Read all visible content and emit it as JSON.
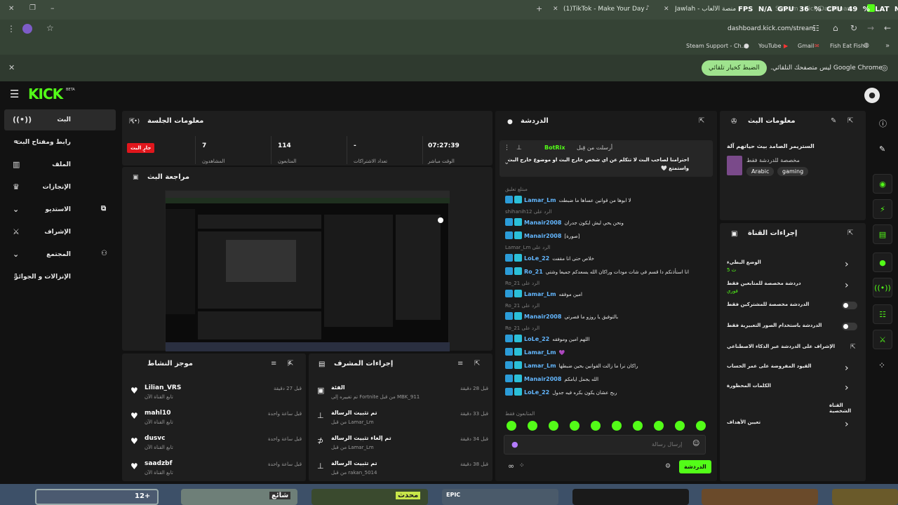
{
  "browser": {
    "tabs": [
      "(1)TikTok - Make Your Day",
      "Jawlah - منصة الألعاب",
      "Stream - Kick Dashboard"
    ],
    "overlay": "FPS N/A  GPU 36 %  CPU 49 %  LAT N/A",
    "url": "dashboard.kick.com/stream",
    "bookmarks": [
      "Steam Support - Ch...",
      "YouTube",
      "Gmail",
      "Fish Eat Fish"
    ],
    "infobar_text": "Google Chrome ليس متصفحك التلقائي.",
    "infobar_button": "الضبط كخيار تلقائي"
  },
  "kick": {
    "logo": "KICK",
    "beta": "BETA"
  },
  "sidebar": {
    "items": [
      {
        "label": "البث",
        "icon": "broadcast-icon",
        "active": true
      },
      {
        "label": "رابط ومفتاح البث",
        "icon": "link-icon"
      },
      {
        "label": "الملف",
        "icon": "chart-icon"
      },
      {
        "label": "الإنجازات",
        "icon": "trophy-icon"
      },
      {
        "label": "الاستديو",
        "icon": "studio-icon"
      },
      {
        "label": "الإشراف",
        "icon": "sword-icon"
      },
      {
        "label": "المجتمع",
        "icon": "community-icon"
      },
      {
        "label": "الإنزالات و الجوائز",
        "icon": "drops-icon"
      }
    ]
  },
  "session": {
    "title": "معلومات الجلسة",
    "live_badge": "جارٍ البث",
    "stats": [
      {
        "value": "07:27:39",
        "label": "الوقت مباشر"
      },
      {
        "value": "-",
        "label": "تعداد الاشتراكات"
      },
      {
        "value": "114",
        "label": "المتابعون"
      },
      {
        "value": "7",
        "label": "المشاهدون"
      }
    ]
  },
  "preview": {
    "title": "مراجعة البث"
  },
  "chat": {
    "title": "الدردشة",
    "pinned": {
      "header": "أرسلت من قِبل",
      "user": "BotRix",
      "text": "احترامنا لصاحب البث لا تتكلم عن اي شخص خارج البث او موضوع خارج البث واستمتع 🤍"
    },
    "messages": [
      {
        "user": "Lamar_Lm",
        "text": "لا ابوها من قوانين عساها ما ضبطت",
        "reply": "مبتلع تعليق"
      },
      {
        "user": "Manair2008",
        "text": "ونحن يحي ليش ايكون جدران",
        "reply": "الرد على shihanih12"
      },
      {
        "user": "Manair2008",
        "text": "[صورة]",
        "reply": ""
      },
      {
        "user": "LoLe_22",
        "text": "خلاص حتى انا مقفت",
        "reply": "الرد على Lamar_Lm"
      },
      {
        "user": "Ro_21",
        "text": "انا استأذنكم دا قسم في شات مودات وراكان الله يسعدكم جميعا وشتي",
        "reply": ""
      },
      {
        "user": "Lamar_Lm",
        "text": "امين موفقه",
        "reply": "الرد على Ro_21"
      },
      {
        "user": "Manair2008",
        "text": "بالتوفيق يا روزو ما قصرتي",
        "reply": "الرد على Ro_21"
      },
      {
        "user": "LoLe_22",
        "text": "اللهم امين وموفقه",
        "reply": "الرد على Ro_21"
      },
      {
        "user": "Lamar_Lm",
        "text": "💜",
        "reply": ""
      },
      {
        "user": "Lamar_Lm",
        "text": "راكان نرا ما زالت القوانين بحين ضبطها",
        "reply": ""
      },
      {
        "user": "Manair2008",
        "text": "الله يجمل ايامكم",
        "reply": ""
      },
      {
        "user": "LoLe_22",
        "text": "ربح عشان يكون بكره فيه جدول",
        "reply": ""
      }
    ],
    "followers_only": "المتابعون فقط",
    "input_placeholder": "إرسال رسالة",
    "send_label": "الدردشة"
  },
  "stream_info": {
    "title": "معلومات البث",
    "stream_title": "الستريمر الصامد بيث حياتهم آلة",
    "category": "مخصصة للدردشة فقط",
    "tags": [
      "Arabic",
      "gaming"
    ]
  },
  "channel_actions": {
    "title": "إجراءات القناة",
    "items": [
      {
        "label": "الوضع البطيء",
        "sub": "5 ث",
        "type": "chevron"
      },
      {
        "label": "دردشة مخصصة للمتابعين فقط",
        "sub": "فوري",
        "type": "chevron"
      },
      {
        "label": "الدردشة مخصصة للمشتركين فقط",
        "sub": "",
        "type": "toggle"
      },
      {
        "label": "الدردشة باستخدام الصور التعبيرية فقط",
        "sub": "",
        "type": "toggle"
      },
      {
        "label": "الإشراف على الدردشة عبر الذكاء الاصطناعي",
        "sub": "",
        "type": "link"
      },
      {
        "label": "القيود المفروضة على عمر الحساب",
        "sub": "",
        "type": "chevron"
      },
      {
        "label": "الكلمات المحظورة",
        "sub": "",
        "type": "chevron"
      },
      {
        "label": "القناة الشخصية",
        "sub": "",
        "type": "header"
      },
      {
        "label": "تعيين الأهداف",
        "sub": "",
        "type": "chevron"
      }
    ]
  },
  "activity": {
    "title": "موجز النشاط",
    "items": [
      {
        "user": "Lilian_VRS",
        "sub": "تابع القناة الآن",
        "time": "قبل 27 دقيقة"
      },
      {
        "user": "mahl10",
        "sub": "تابع القناة الآن",
        "time": "قبل ساعة واحدة"
      },
      {
        "user": "dusvc",
        "sub": "تابع القناة الآن",
        "time": "قبل ساعة واحدة"
      },
      {
        "user": "saadzbf",
        "sub": "تابع القناة الآن",
        "time": "قبل ساعة واحدة"
      }
    ]
  },
  "mod_actions": {
    "title": "إجراءات المشرف",
    "items": [
      {
        "title": "الفئة",
        "sub": "تم تغييره إلى Fortnite من قبل MBK_911",
        "time": "قبل 28 دقيقة",
        "icon": "category-icon"
      },
      {
        "title": "تم تثبيت الرسالة",
        "sub": "من قبل Lamar_Lm",
        "time": "قبل 33 دقيقة",
        "icon": "pin-icon"
      },
      {
        "title": "تم إلغاء تثبيت الرسالة",
        "sub": "من قبل Lamar_Lm",
        "time": "قبل 34 دقيقة",
        "icon": "unpin-icon"
      },
      {
        "title": "تم تثبيت الرسالة",
        "sub": "من قبل rakan_5014",
        "time": "قبل 38 دقيقة",
        "icon": "pin-icon"
      }
    ]
  },
  "taskbar": {
    "thumbs": [
      "12+",
      "شائع",
      "محدث",
      "EPIC"
    ]
  },
  "colors": {
    "accent": "#53fc18",
    "live": "#e0161c",
    "chrome": "#354335",
    "panel": "#1e1e1e"
  }
}
